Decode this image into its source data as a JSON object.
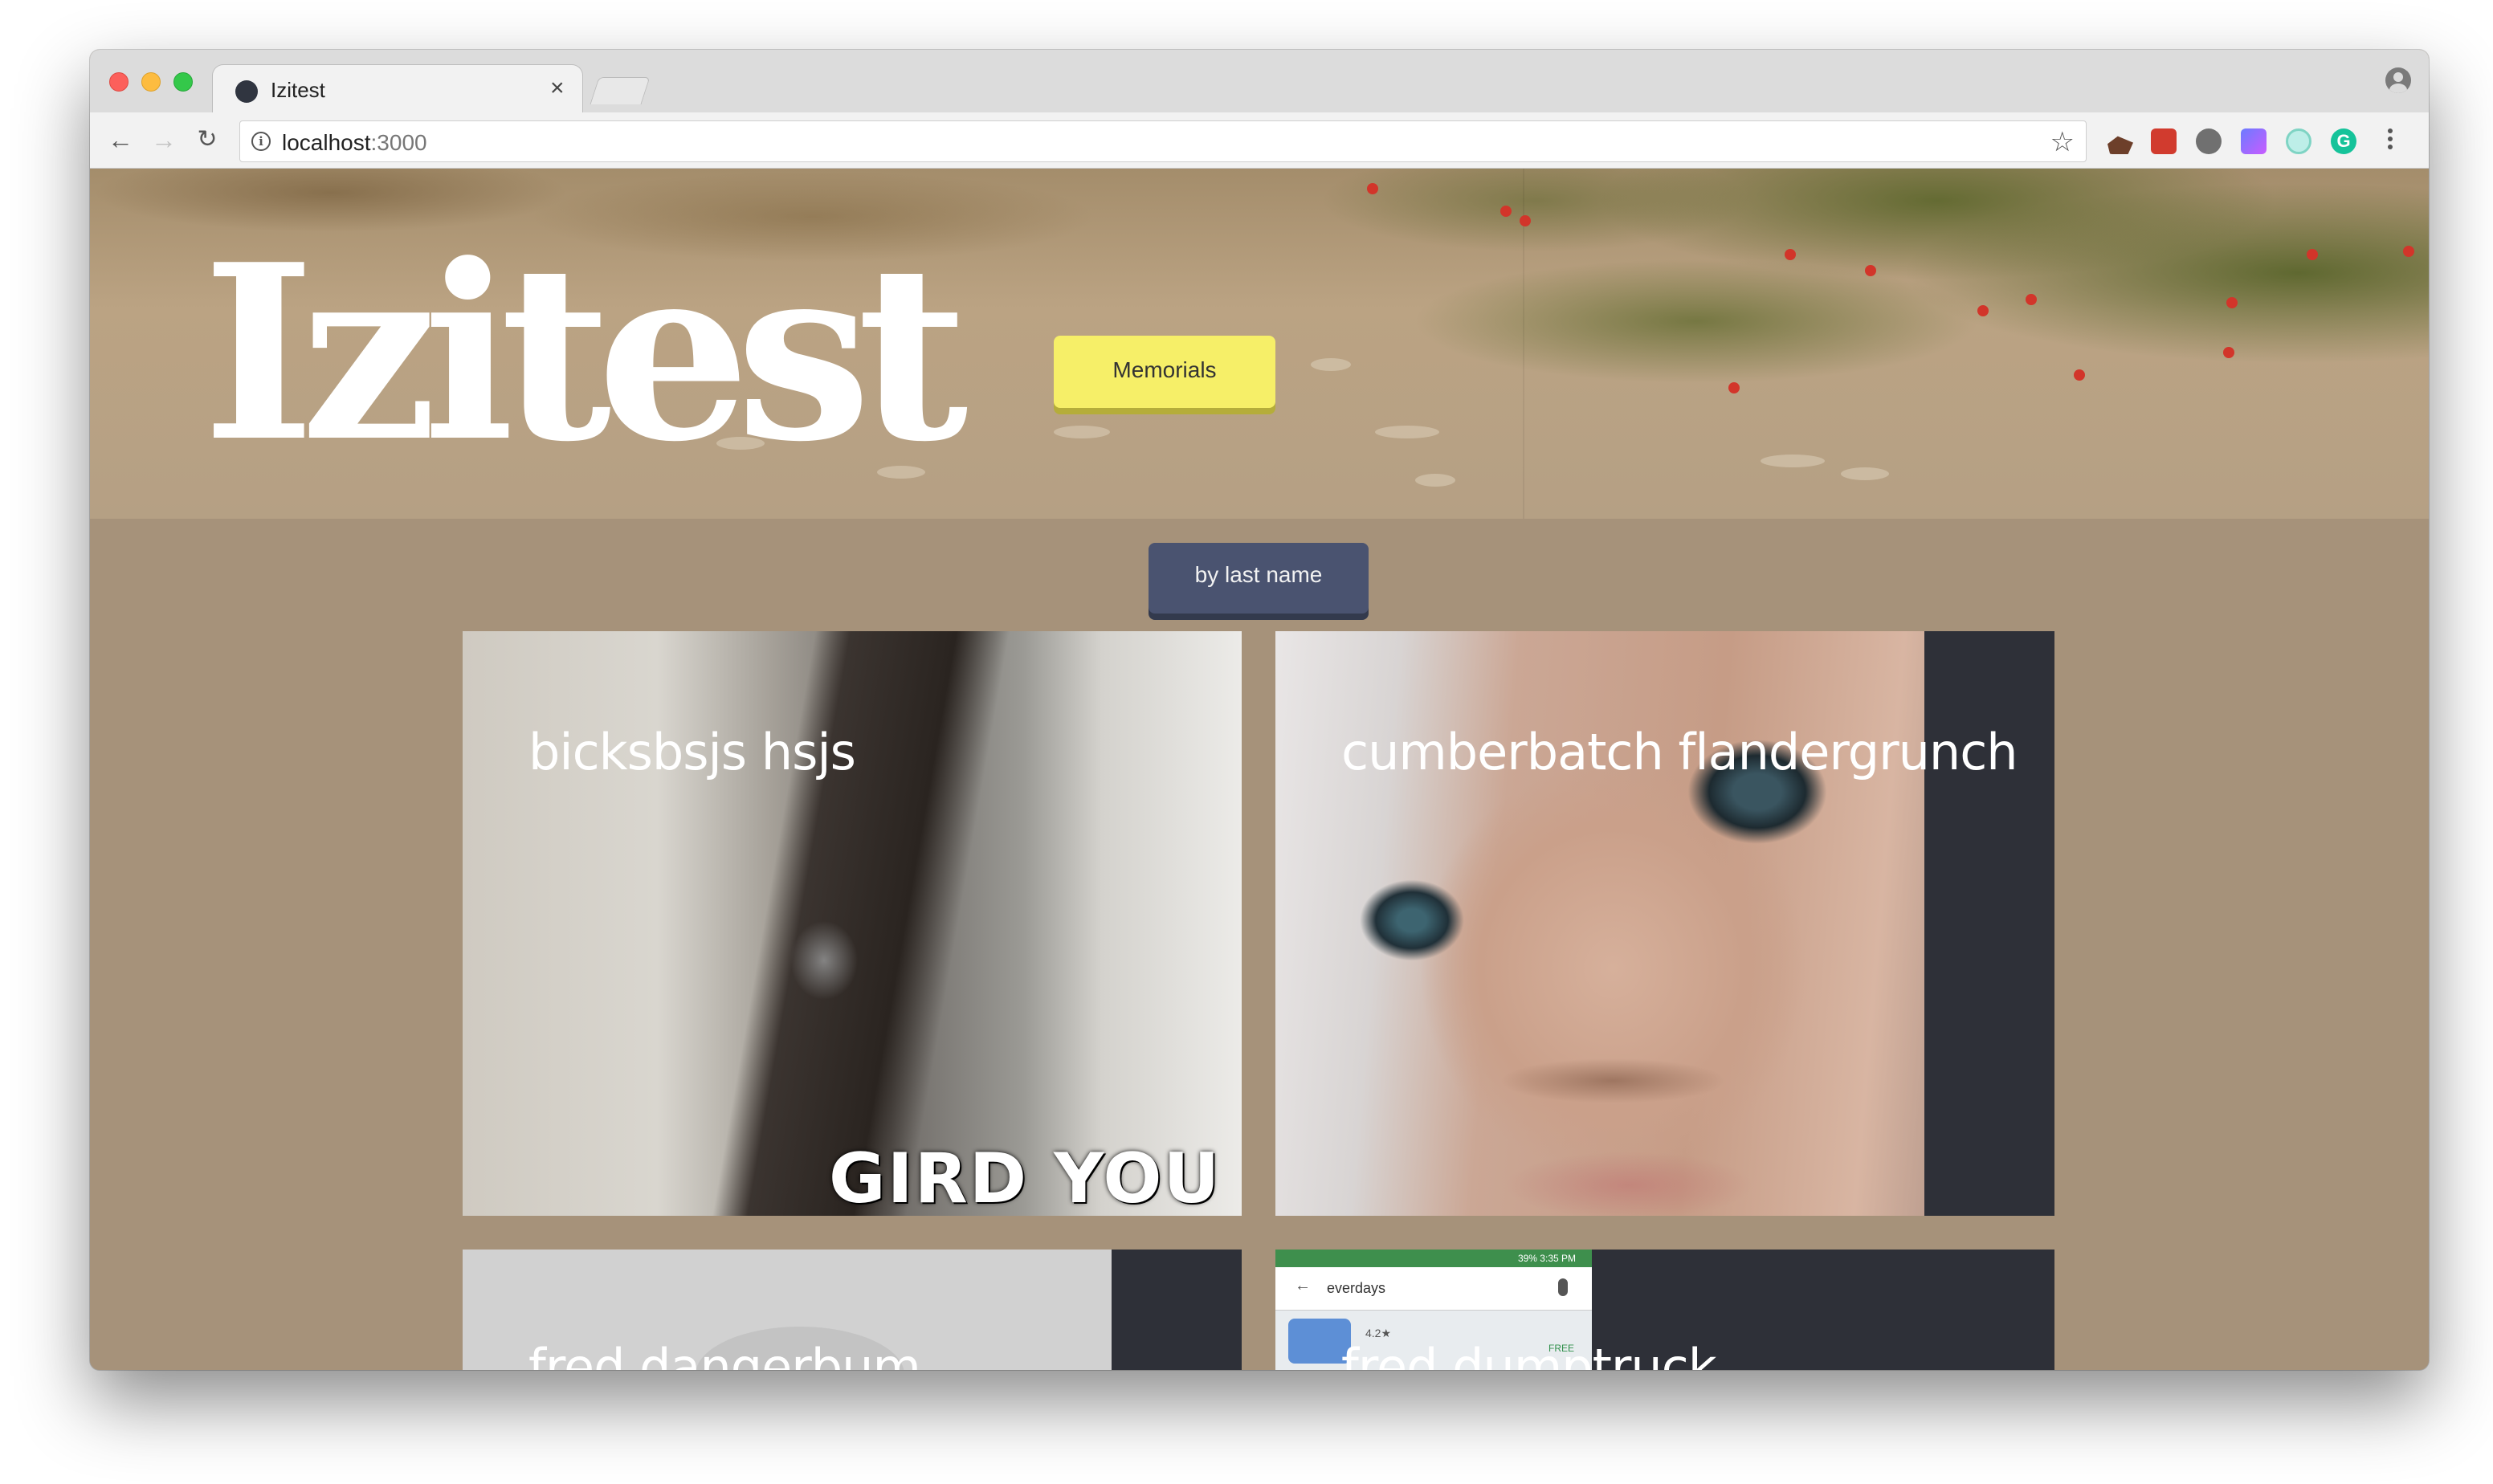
{
  "browser": {
    "tab_title": "Izitest",
    "tab_close": "×",
    "url_host": "localhost",
    "url_port": ":3000",
    "nav_back": "←",
    "nav_forward": "→",
    "nav_reload": "↻",
    "bookmark_star": "☆",
    "grammarly_letter": "G",
    "info_glyph": "i"
  },
  "header": {
    "site_title": "Izitest",
    "memorials_label": "Memorials"
  },
  "controls": {
    "sort_label": "by last name"
  },
  "memorials": [
    {
      "name": "bicksbsjs hsjs",
      "caption": "GIRD YOU"
    },
    {
      "name": "cumberbatch flandergrunch"
    },
    {
      "name": "fred dangerbum"
    },
    {
      "name": "fred dumptruck",
      "screenshot_search": "everdays",
      "screenshot_rating": "4.2★",
      "screenshot_badge": "FREE",
      "screenshot_status": "39% 3:35 PM"
    }
  ],
  "colors": {
    "page_bg": "#a6927a",
    "memorials_button": "#f6ef68",
    "sort_button": "#4a5370",
    "card_bg": "#2e3038"
  }
}
